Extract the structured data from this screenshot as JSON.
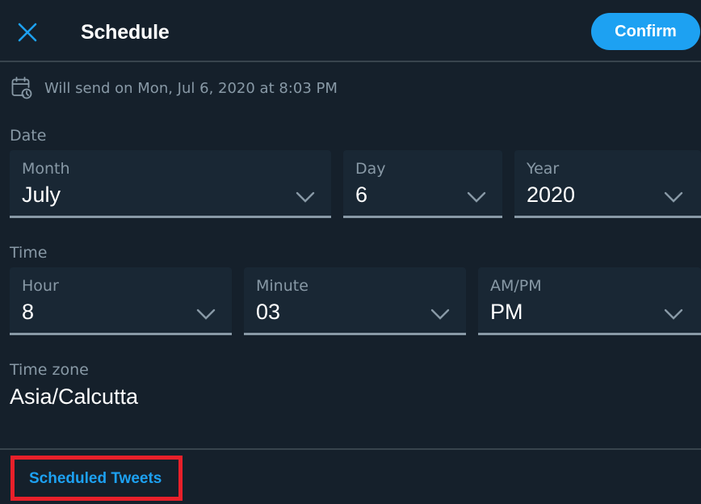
{
  "header": {
    "close_icon": "close-icon",
    "title": "Schedule",
    "confirm_label": "Confirm"
  },
  "summary": {
    "icon": "calendar-clock-icon",
    "text": "Will send on Mon, Jul 6, 2020 at 8:03 PM"
  },
  "date": {
    "section_label": "Date",
    "fields": [
      {
        "label": "Month",
        "value": "July"
      },
      {
        "label": "Day",
        "value": "6"
      },
      {
        "label": "Year",
        "value": "2020"
      }
    ]
  },
  "time": {
    "section_label": "Time",
    "fields": [
      {
        "label": "Hour",
        "value": "8"
      },
      {
        "label": "Minute",
        "value": "03"
      },
      {
        "label": "AM/PM",
        "value": "PM"
      }
    ]
  },
  "timezone": {
    "section_label": "Time zone",
    "value": "Asia/Calcutta"
  },
  "footer": {
    "scheduled_link": "Scheduled Tweets"
  },
  "colors": {
    "background": "#15202b",
    "field_background": "#192734",
    "accent": "#1da1f2",
    "muted_text": "#8899a6",
    "divider": "#38444d",
    "highlight": "#e8202a"
  }
}
